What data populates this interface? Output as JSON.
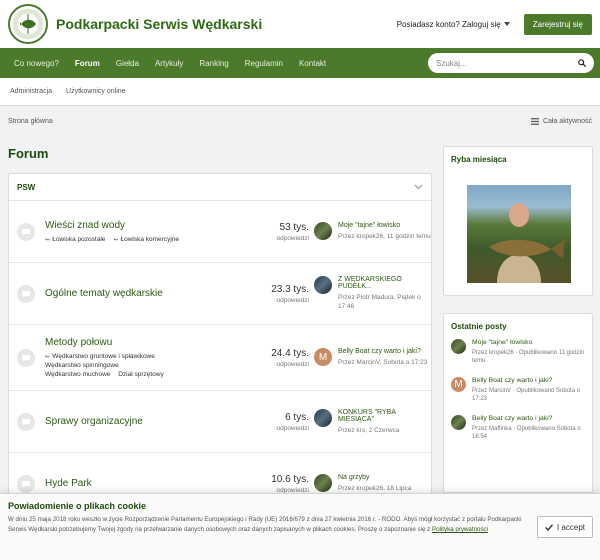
{
  "header": {
    "site_title": "Podkarpacki Serwis Wędkarski",
    "account_label": "Posiadasz konto? Zaloguj się",
    "register_label": "Zarejestruj się"
  },
  "nav": {
    "items": [
      "Co nowego?",
      "Forum",
      "Giełda",
      "Artykuły",
      "Ranking",
      "Regulamin",
      "Kontakt"
    ],
    "active": "Forum",
    "search_placeholder": "Szukaj..."
  },
  "subnav": {
    "items": [
      "Administracja",
      "Użytkownicy online"
    ]
  },
  "breadcrumb": {
    "home": "Strona główna",
    "all_activity": "Cała aktywność"
  },
  "page": {
    "title": "Forum"
  },
  "category": {
    "name": "PSW",
    "forums": [
      {
        "title": "Wieści znad wody",
        "subforums": [
          "Łowiska pozostałe",
          "Łowiska komercyjne"
        ],
        "count": "53 tys.",
        "count_label": "odpowiedzi",
        "last_title": "Moje \"tajne\" łowisko",
        "last_meta": "Przez kropek26, 11 godzin temu"
      },
      {
        "title": "Ogólne tematy wędkarskie",
        "subforums": [],
        "count": "23.3 tys.",
        "count_label": "odpowiedzi",
        "last_title": "Z WĘDKARSKIEGO PUDEŁK...",
        "last_meta": "Przez Piotr Madura, Piątek o 17:46"
      },
      {
        "title": "Metody połowu",
        "subforums": [
          "Wędkarstwo gruntowe i spławikowe",
          "Wędkarstwo spinningowe",
          "Wędkarstwo muchowe",
          "Dział sprzętowy"
        ],
        "count": "24.4 tys.",
        "count_label": "odpowiedzi",
        "last_title": "Belly Boat czy warto i jaki?",
        "last_meta": "Przez MarcinV, Sobota o 17:23",
        "avatar_letter": "M"
      },
      {
        "title": "Sprawy organizacyjne",
        "subforums": [],
        "count": "6 tys.",
        "count_label": "odpowiedzi",
        "last_title": "KONKURS \"RYBA MIESIĄCA\"",
        "last_meta": "Przez krs, 2 Czerwca"
      },
      {
        "title": "Hyde Park",
        "subforums": [],
        "count": "10.6 tys.",
        "count_label": "odpowiedzi",
        "last_title": "Na grzyby",
        "last_meta": "Przez kropek26, 18 Lipca"
      }
    ]
  },
  "sidebar": {
    "fish_title": "Ryba miesiąca",
    "posts_title": "Ostatnie posty",
    "posts": [
      {
        "title": "Moje \"tajne\" łowisko",
        "meta": "Przez kropek26 · Opublikowano 11 godzin temu"
      },
      {
        "title": "Belly Boat czy warto i jaki?",
        "meta": "Przez MarcinV · Opublikowano Sobota o 17:23",
        "avatar_letter": "M"
      },
      {
        "title": "Belly Boat czy warto i jaki?",
        "meta": "Przez Maffinka · Opublikowano Sobota o 16:54"
      }
    ]
  },
  "cookie": {
    "title": "Powiadomienie o plikach cookie",
    "text": "W dniu 25 maja 2018 roku weszło w życie Rozporządzenie Parlamentu Europejskiego i Rady (UE) 2016/679 z dnia 27 kwietnia 2016 r. - RODO. Abyś mógł korzystać z portalu Podkarpacki Serwis Wędkarski potrzebujemy Twojej zgody na przetwarzanie danych osobowych oraz danych zapisanych w plikach cookies. Proszę o zapoznanie się z",
    "link": "Polityką prywatności",
    "accept_label": "I accept"
  },
  "colors": {
    "brand": "#4b7a2b",
    "title": "#1e4d0c",
    "link": "#2b5a12"
  }
}
